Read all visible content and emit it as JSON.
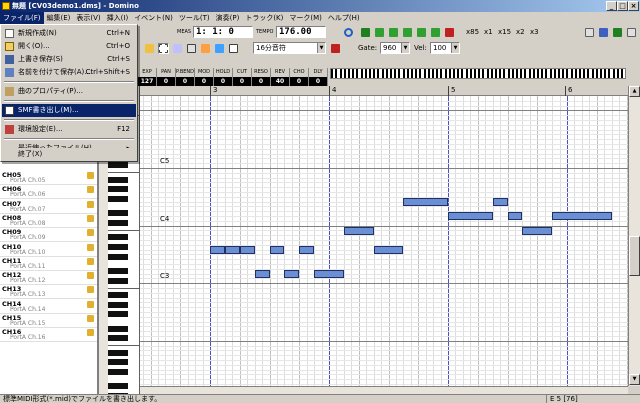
{
  "window": {
    "title": "無題 [CV03demo1.dms] - Domino"
  },
  "menubar": [
    {
      "label": "ファイル(F)"
    },
    {
      "label": "編集(E)"
    },
    {
      "label": "表示(V)"
    },
    {
      "label": "挿入(I)"
    },
    {
      "label": "イベント(N)"
    },
    {
      "label": "ツール(T)"
    },
    {
      "label": "演奏(P)"
    },
    {
      "label": "トラック(K)"
    },
    {
      "label": "マーク(M)"
    },
    {
      "label": "ヘルプ(H)"
    }
  ],
  "file_menu": [
    {
      "label": "新規作成(N)",
      "shortcut": "Ctrl+N",
      "icon": "new-file-icon"
    },
    {
      "label": "開く(O)...",
      "shortcut": "Ctrl+O",
      "icon": "open-folder-icon"
    },
    {
      "label": "上書き保存(S)",
      "shortcut": "Ctrl+S",
      "icon": "save-icon"
    },
    {
      "label": "名前を付けて保存(A)...",
      "shortcut": "Ctrl+Shift+S",
      "icon": "save-as-icon"
    },
    {
      "label": "曲のプロパティ(P)...",
      "shortcut": "",
      "icon": "properties-icon"
    },
    {
      "label": "SMF書き出し(M)...",
      "shortcut": "",
      "icon": "smf-export-icon",
      "highlighted": true
    },
    {
      "label": "環境設定(E)...",
      "shortcut": "F12",
      "icon": "settings-icon"
    },
    {
      "label": "最近使ったファイル(H)",
      "shortcut": "▸",
      "icon": ""
    },
    {
      "label": "終了(X)",
      "shortcut": "",
      "icon": ""
    }
  ],
  "transport": {
    "position": "1: 1:   0",
    "meas_label": "MEAS",
    "tempo_label": "TEMPO",
    "tempo": "176.00"
  },
  "zoom": {
    "labels": [
      "x85",
      "x1",
      "x15",
      "x2",
      "x3"
    ]
  },
  "snap": {
    "value": "16分音符"
  },
  "gate": {
    "label": "Gate:",
    "value": "960"
  },
  "vel": {
    "label": "Vel:",
    "value": "100"
  },
  "controllers": [
    {
      "name": "EXP",
      "value": "127"
    },
    {
      "name": "PAN",
      "value": "0"
    },
    {
      "name": "P.BEND",
      "value": "0"
    },
    {
      "name": "MOD",
      "value": "0"
    },
    {
      "name": "HOLD",
      "value": "0"
    },
    {
      "name": "CUT",
      "value": "0"
    },
    {
      "name": "RESO",
      "value": "0"
    },
    {
      "name": "REV",
      "value": "40"
    },
    {
      "name": "CHO",
      "value": "0"
    },
    {
      "name": "DLY",
      "value": "0"
    }
  ],
  "tracks": [
    {
      "name": "CH05",
      "port": "PortA  Ch.05"
    },
    {
      "name": "CH06",
      "port": "PortA  Ch.06"
    },
    {
      "name": "CH07",
      "port": "PortA  Ch.07"
    },
    {
      "name": "CH08",
      "port": "PortA  Ch.08"
    },
    {
      "name": "CH09",
      "port": "PortA  Ch.09"
    },
    {
      "name": "CH10",
      "port": "PortA  Ch.10"
    },
    {
      "name": "CH11",
      "port": "PortA  Ch.11"
    },
    {
      "name": "CH12",
      "port": "PortA  Ch.12"
    },
    {
      "name": "CH13",
      "port": "PortA  Ch.13"
    },
    {
      "name": "CH14",
      "port": "PortA  Ch.14"
    },
    {
      "name": "CH15",
      "port": "PortA  Ch.15"
    },
    {
      "name": "CH16",
      "port": "PortA  Ch.16"
    }
  ],
  "ruler": {
    "measures": [
      "3",
      "4",
      "5",
      "6"
    ]
  },
  "octaves": [
    "C5",
    "C4",
    "C3"
  ],
  "notes": [
    {
      "measure": 3,
      "beat": 0.0,
      "length": 0.5,
      "pitch": "G3"
    },
    {
      "measure": 3,
      "beat": 0.5,
      "length": 0.5,
      "pitch": "G3"
    },
    {
      "measure": 3,
      "beat": 1.0,
      "length": 0.5,
      "pitch": "G3"
    },
    {
      "measure": 3,
      "beat": 2.0,
      "length": 0.5,
      "pitch": "G3"
    },
    {
      "measure": 3,
      "beat": 3.0,
      "length": 0.5,
      "pitch": "G3"
    },
    {
      "measure": 3,
      "beat": 1.5,
      "length": 0.5,
      "pitch": "D3"
    },
    {
      "measure": 3,
      "beat": 2.5,
      "length": 0.5,
      "pitch": "D3"
    },
    {
      "measure": 3,
      "beat": 3.5,
      "length": 1.0,
      "pitch": "D3"
    },
    {
      "measure": 4,
      "beat": 0.5,
      "length": 1.0,
      "pitch": "B3"
    },
    {
      "measure": 4,
      "beat": 1.5,
      "length": 1.0,
      "pitch": "G3"
    },
    {
      "measure": 4,
      "beat": 2.5,
      "length": 1.5,
      "pitch": "F4"
    },
    {
      "measure": 4,
      "beat": 4.0,
      "length": 1.5,
      "pitch": "D4"
    },
    {
      "measure": 5,
      "beat": 1.5,
      "length": 0.5,
      "pitch": "F4"
    },
    {
      "measure": 5,
      "beat": 2.0,
      "length": 0.5,
      "pitch": "D4"
    },
    {
      "measure": 5,
      "beat": 2.5,
      "length": 1.0,
      "pitch": "B3"
    },
    {
      "measure": 5,
      "beat": 3.5,
      "length": 2.0,
      "pitch": "D4"
    }
  ],
  "status": {
    "text": "標準MIDI形式(*.mid)でファイルを書き出します。",
    "position": "E 5 [76]"
  }
}
